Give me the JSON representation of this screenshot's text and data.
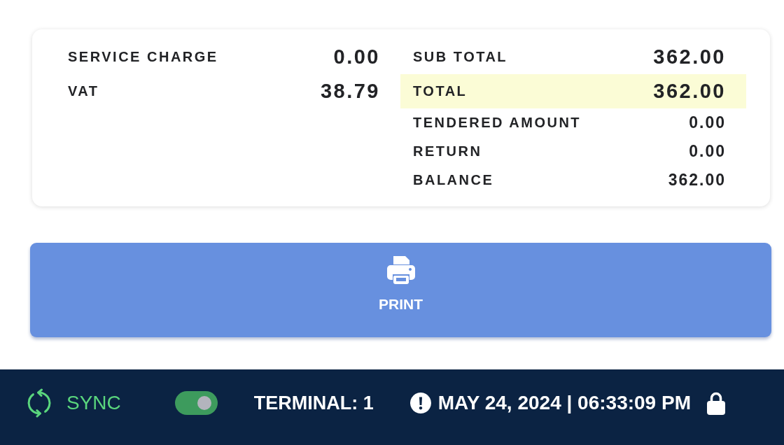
{
  "summary": {
    "left_rows": [
      {
        "label": "SERVICE CHARGE",
        "value": "0.00"
      },
      {
        "label": "VAT",
        "value": "38.79"
      }
    ],
    "right_rows": [
      {
        "label": "SUB TOTAL",
        "value": "362.00",
        "kind": "major"
      },
      {
        "label": "TOTAL",
        "value": "362.00",
        "kind": "grand"
      },
      {
        "label": "TENDERED AMOUNT",
        "value": "0.00",
        "kind": "minor"
      },
      {
        "label": "RETURN",
        "value": "0.00",
        "kind": "minor"
      },
      {
        "label": "BALANCE",
        "value": "362.00",
        "kind": "minor"
      }
    ]
  },
  "print_button": {
    "label": "PRINT"
  },
  "status_bar": {
    "sync_label": "SYNC",
    "toggle": {
      "on": true
    },
    "terminal": "TERMINAL: 1",
    "datetime": "MAY 24, 2024 | 06:33:09 PM"
  }
}
